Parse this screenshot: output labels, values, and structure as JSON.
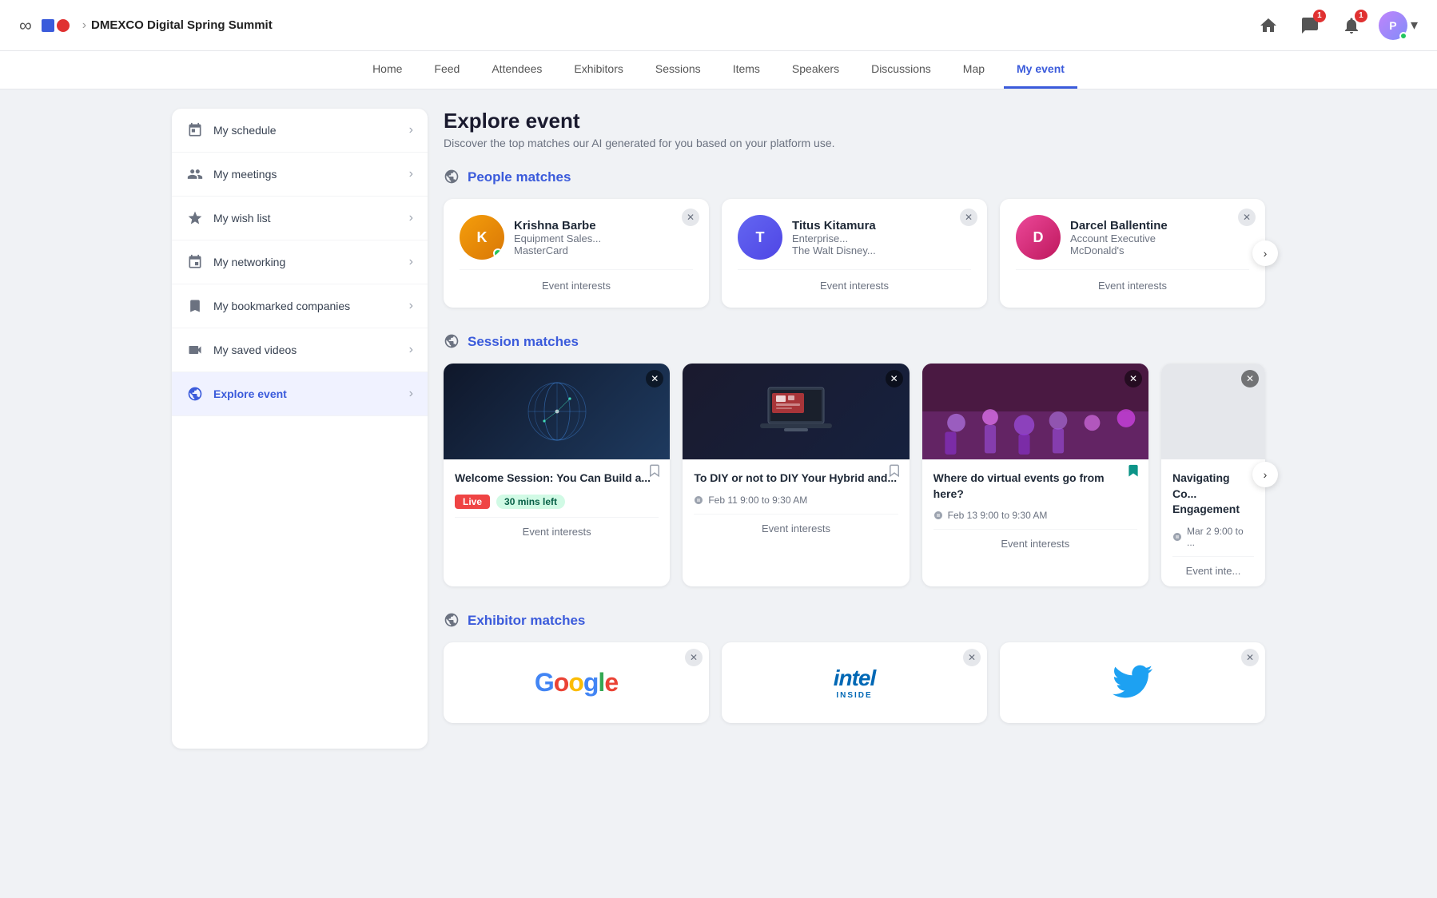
{
  "app": {
    "logo_infinity": "∞",
    "event_name": "DMEXCO Digital Spring Summit"
  },
  "header": {
    "icons": {
      "home_label": "home",
      "messages_label": "messages",
      "messages_badge": "1",
      "notifications_label": "notifications",
      "notifications_badge": "1",
      "avatar_initials": "P"
    }
  },
  "nav": {
    "items": [
      {
        "label": "Home",
        "active": false
      },
      {
        "label": "Feed",
        "active": false
      },
      {
        "label": "Attendees",
        "active": false
      },
      {
        "label": "Exhibitors",
        "active": false
      },
      {
        "label": "Sessions",
        "active": false
      },
      {
        "label": "Items",
        "active": false
      },
      {
        "label": "Speakers",
        "active": false
      },
      {
        "label": "Discussions",
        "active": false
      },
      {
        "label": "Map",
        "active": false
      },
      {
        "label": "My event",
        "active": true
      }
    ]
  },
  "sidebar": {
    "items": [
      {
        "id": "my-schedule",
        "label": "My schedule",
        "icon": "calendar"
      },
      {
        "id": "my-meetings",
        "label": "My meetings",
        "icon": "users"
      },
      {
        "id": "my-wish-list",
        "label": "My wish list",
        "icon": "star"
      },
      {
        "id": "my-networking",
        "label": "My networking",
        "icon": "network"
      },
      {
        "id": "my-bookmarked-companies",
        "label": "My bookmarked companies",
        "icon": "bookmark"
      },
      {
        "id": "my-saved-videos",
        "label": "My saved videos",
        "icon": "video"
      },
      {
        "id": "explore-event",
        "label": "Explore event",
        "icon": "explore",
        "active": true
      }
    ]
  },
  "content": {
    "page_title": "Explore event",
    "page_subtitle": "Discover the top matches our AI generated for you based on your platform use.",
    "people_matches": {
      "section_title": "People matches",
      "people": [
        {
          "name": "Krishna Barbe",
          "role": "Equipment Sales...",
          "company": "MasterCard",
          "has_online_dot": true
        },
        {
          "name": "Titus Kitamura",
          "role": "Enterprise...",
          "company": "The Walt Disney...",
          "has_online_dot": false
        },
        {
          "name": "Darcel Ballentine",
          "role": "Account Executive",
          "company": "McDonald's",
          "has_online_dot": false
        }
      ],
      "event_interests_label": "Event interests"
    },
    "session_matches": {
      "section_title": "Session matches",
      "sessions": [
        {
          "title": "Welcome Session: You Can Build a...",
          "badge_live": "Live",
          "badge_time": "30 mins left",
          "img_type": "globe",
          "bookmarked": false,
          "event_interests_label": "Event interests"
        },
        {
          "title": "To DIY or not to DIY Your Hybrid and...",
          "date": "Feb 11 9:00 to 9:30 AM",
          "img_type": "laptop",
          "bookmarked": false,
          "event_interests_label": "Event interests"
        },
        {
          "title": "Where do virtual events go from here?",
          "date": "Feb 13 9:00 to 9:30 AM",
          "img_type": "crowd",
          "bookmarked": true,
          "event_interests_label": "Event interests"
        },
        {
          "title": "Navigating Co... Engagement",
          "date": "Mar 2 9:00 to ...",
          "img_type": "partial",
          "bookmarked": false,
          "event_interests_label": "Event inte..."
        }
      ]
    },
    "exhibitor_matches": {
      "section_title": "Exhibitor matches",
      "exhibitors": [
        {
          "name": "Google",
          "logo_type": "google"
        },
        {
          "name": "Intel",
          "logo_type": "intel"
        },
        {
          "name": "Twitter",
          "logo_type": "twitter"
        }
      ]
    }
  }
}
